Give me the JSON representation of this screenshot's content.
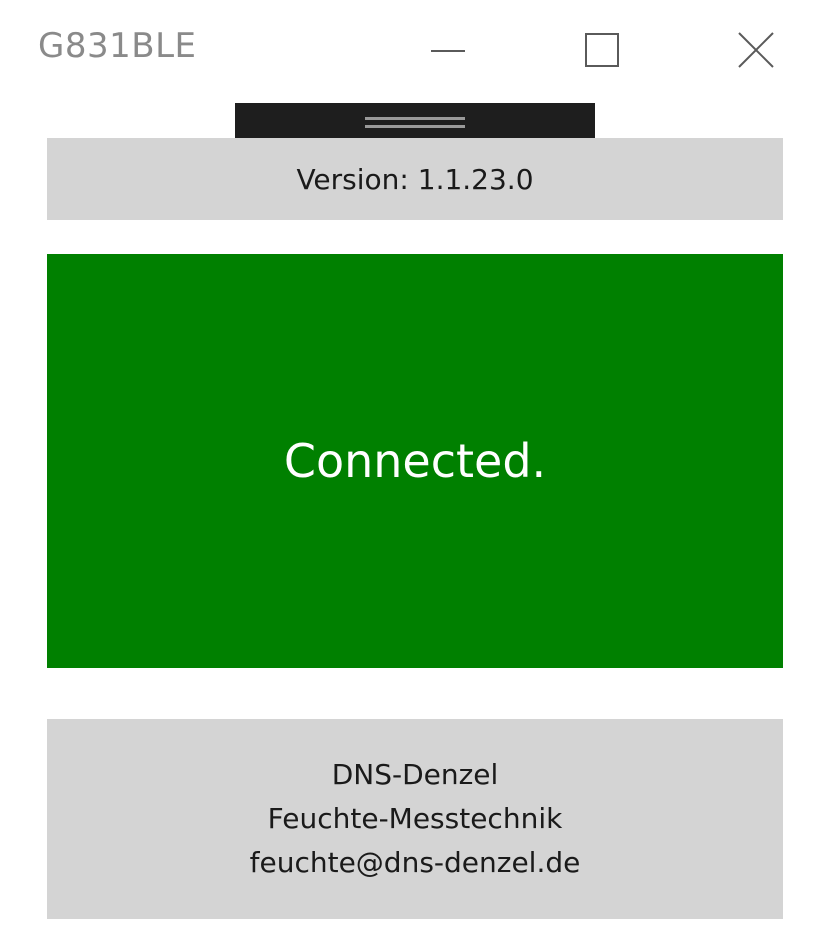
{
  "window": {
    "title": "G831BLE",
    "minimize_icon": "minimize-icon",
    "maximize_icon": "maximize-icon",
    "close_icon": "close-icon"
  },
  "drag_handle": {
    "icon": "grip-icon"
  },
  "version": {
    "text": "Version: 1.1.23.0"
  },
  "status": {
    "text": "Connected.",
    "color": "#008000"
  },
  "company": {
    "name": "DNS-Denzel",
    "subtitle": "Feuchte-Messtechnik",
    "email": "feuchte@dns-denzel.de"
  }
}
